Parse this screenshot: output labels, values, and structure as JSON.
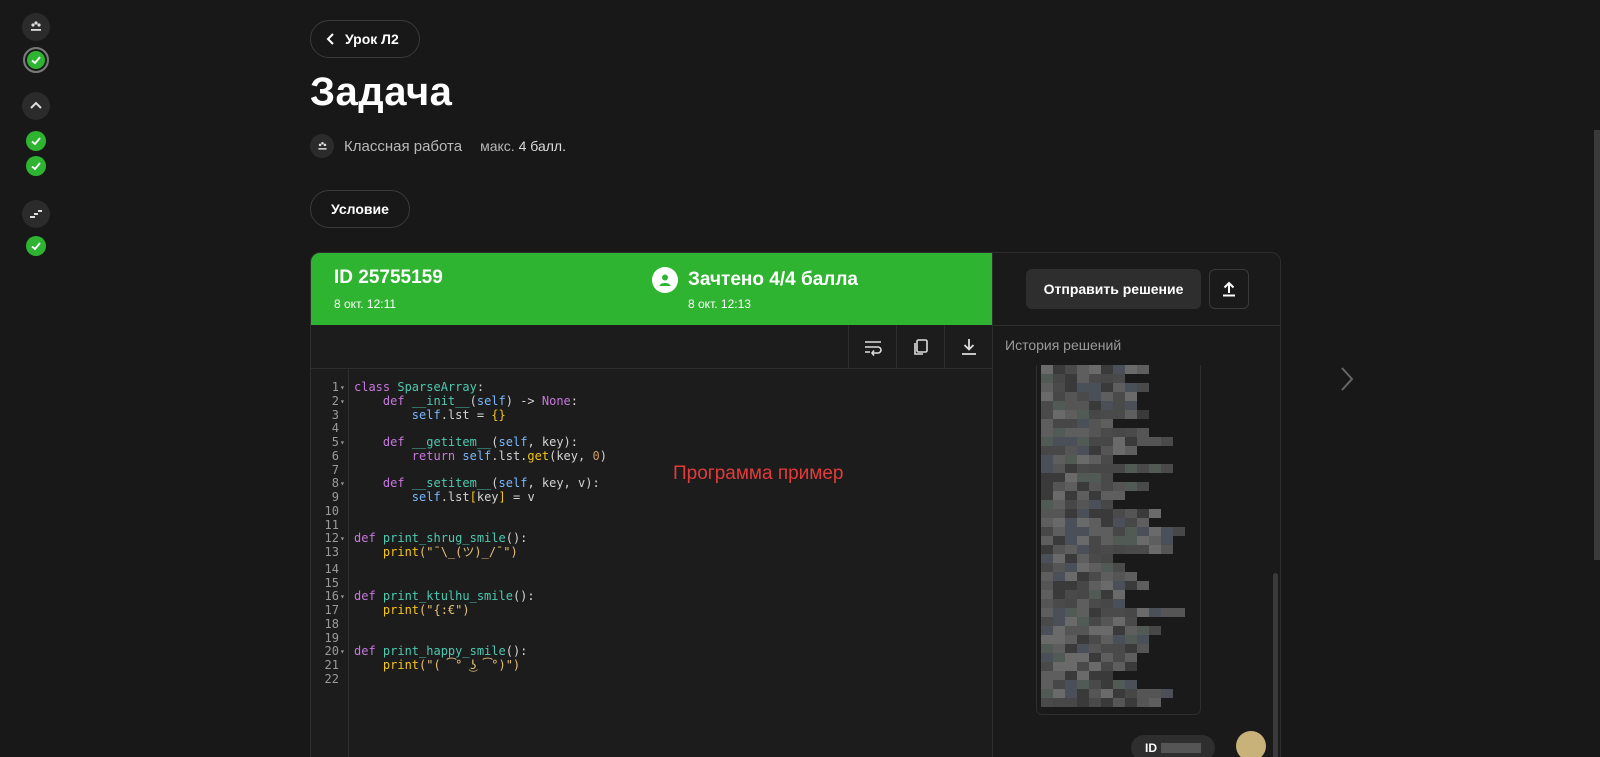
{
  "back_button": {
    "label": "Урок Л2"
  },
  "page_title": "Задача",
  "meta": {
    "label": "Классная работа",
    "max_label": "макс.",
    "max_value": "4 балл."
  },
  "tab": {
    "label": "Условие"
  },
  "submission": {
    "id_label": "ID 25755159",
    "date": "8 окт. 12:11",
    "verdict": "Зачтено 4/4 балла",
    "verdict_date": "8 окт. 12:13",
    "status_color": "#2fb432"
  },
  "right_panel": {
    "send_label": "Отправить решение",
    "history_title": "История решений",
    "id_pill": "ID"
  },
  "editor": {
    "note": "Программа пример",
    "lines": [
      {
        "n": "1",
        "fold": "▾"
      },
      {
        "n": "2",
        "fold": "▾"
      },
      {
        "n": "3",
        "fold": ""
      },
      {
        "n": "4",
        "fold": ""
      },
      {
        "n": "5",
        "fold": "▾"
      },
      {
        "n": "6",
        "fold": ""
      },
      {
        "n": "7",
        "fold": ""
      },
      {
        "n": "8",
        "fold": "▾"
      },
      {
        "n": "9",
        "fold": ""
      },
      {
        "n": "10",
        "fold": ""
      },
      {
        "n": "11",
        "fold": ""
      },
      {
        "n": "12",
        "fold": "▾"
      },
      {
        "n": "13",
        "fold": ""
      },
      {
        "n": "14",
        "fold": ""
      },
      {
        "n": "15",
        "fold": ""
      },
      {
        "n": "16",
        "fold": "▾"
      },
      {
        "n": "17",
        "fold": ""
      },
      {
        "n": "18",
        "fold": ""
      },
      {
        "n": "19",
        "fold": ""
      },
      {
        "n": "20",
        "fold": "▾"
      },
      {
        "n": "21",
        "fold": ""
      },
      {
        "n": "22",
        "fold": ""
      }
    ],
    "code": {
      "l1": [
        "class",
        "SparseArray",
        ":"
      ],
      "l2": [
        "def",
        "__init__",
        "(",
        "self",
        ") -> ",
        "None",
        ":"
      ],
      "l3": [
        "self",
        ".lst = ",
        "{}"
      ],
      "l5": [
        "def",
        "__getitem__",
        "(",
        "self",
        ", key):"
      ],
      "l6": [
        "return",
        "self",
        ".lst.",
        "get",
        "(key, ",
        "0",
        ")"
      ],
      "l8": [
        "def",
        "__setitem__",
        "(",
        "self",
        ", key, v):"
      ],
      "l9": [
        "self",
        ".lst",
        "[",
        "key",
        "]",
        " = v"
      ],
      "l12": [
        "def",
        "print_shrug_smile",
        "():"
      ],
      "l13": [
        "print",
        "(\"¯\\_(ツ)_/¯\")"
      ],
      "l16": [
        "def",
        "print_ktulhu_smile",
        "():"
      ],
      "l17": [
        "print",
        "(\"{:€\")"
      ],
      "l20": [
        "def",
        "print_happy_smile",
        "():"
      ],
      "l21": [
        "print",
        "(\"( ͡° ͜ʖ ͡°)\")"
      ]
    }
  },
  "icons": {
    "back": "chevron-left-icon",
    "wrap": "wrap-lines-icon",
    "copy": "copy-icon",
    "download": "download-icon",
    "upload": "upload-icon",
    "next": "chevron-right-icon"
  }
}
